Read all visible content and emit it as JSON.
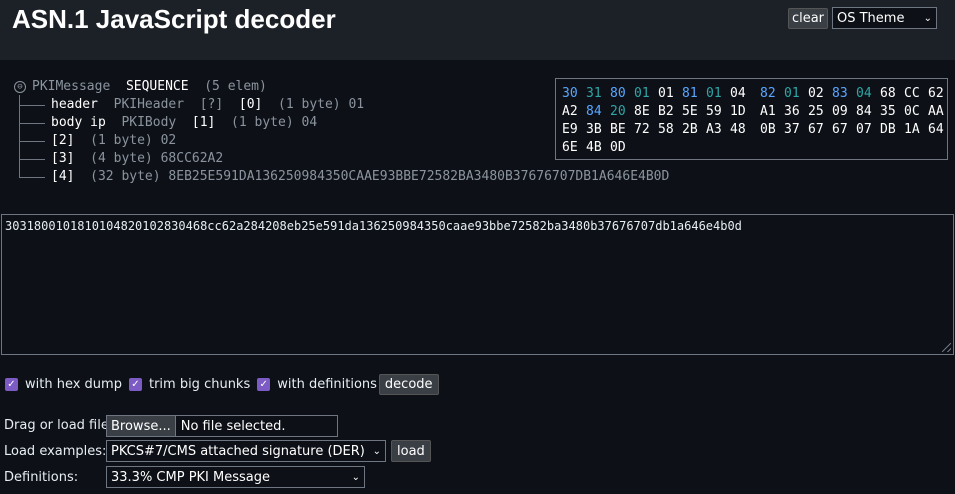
{
  "header": {
    "title": "ASN.1 JavaScript decoder",
    "clear_label": "clear",
    "theme_value": "OS Theme"
  },
  "tree": {
    "root": {
      "toggle": "⊖",
      "name": "PKIMessage",
      "type": "SEQUENCE",
      "info": "(5 elem)"
    },
    "children": [
      {
        "name": "header",
        "type": "PKIHeader",
        "extra": "[?]",
        "tag": "[0]",
        "info": "(1 byte)",
        "value": "01"
      },
      {
        "name": "body ip",
        "type": "PKIBody",
        "tag": "[1]",
        "info": "(1 byte)",
        "value": "04"
      },
      {
        "tag": "[2]",
        "info": "(1 byte)",
        "value": "02"
      },
      {
        "tag": "[3]",
        "info": "(4 byte)",
        "value": "68CC62A2"
      },
      {
        "tag": "[4]",
        "info": "(32 byte)",
        "value": "8EB25E591DA136250984350CAAE93BBE72582BA3480B37676707DB1A646E4B0D"
      }
    ]
  },
  "hexdump": {
    "rows": [
      [
        {
          "t": "30",
          "c": "blue"
        },
        {
          "t": "31",
          "c": "teal"
        },
        {
          "t": "80",
          "c": "blue"
        },
        {
          "t": "01",
          "c": "teal"
        },
        {
          "t": "01",
          "c": "white"
        },
        {
          "t": "81",
          "c": "blue"
        },
        {
          "t": "01",
          "c": "teal"
        },
        {
          "t": "04",
          "c": "white"
        },
        {
          "t": "82",
          "c": "blue"
        },
        {
          "t": "01",
          "c": "teal"
        },
        {
          "t": "02",
          "c": "white"
        },
        {
          "t": "83",
          "c": "blue"
        },
        {
          "t": "04",
          "c": "teal"
        },
        {
          "t": "68",
          "c": "white"
        },
        {
          "t": "CC",
          "c": "white"
        },
        {
          "t": "62",
          "c": "white"
        }
      ],
      [
        {
          "t": "A2",
          "c": "white"
        },
        {
          "t": "84",
          "c": "blue"
        },
        {
          "t": "20",
          "c": "teal"
        },
        {
          "t": "8E",
          "c": "white"
        },
        {
          "t": "B2",
          "c": "white"
        },
        {
          "t": "5E",
          "c": "white"
        },
        {
          "t": "59",
          "c": "white"
        },
        {
          "t": "1D",
          "c": "white"
        },
        {
          "t": "A1",
          "c": "white"
        },
        {
          "t": "36",
          "c": "white"
        },
        {
          "t": "25",
          "c": "white"
        },
        {
          "t": "09",
          "c": "white"
        },
        {
          "t": "84",
          "c": "white"
        },
        {
          "t": "35",
          "c": "white"
        },
        {
          "t": "0C",
          "c": "white"
        },
        {
          "t": "AA",
          "c": "white"
        }
      ],
      [
        {
          "t": "E9",
          "c": "white"
        },
        {
          "t": "3B",
          "c": "white"
        },
        {
          "t": "BE",
          "c": "white"
        },
        {
          "t": "72",
          "c": "white"
        },
        {
          "t": "58",
          "c": "white"
        },
        {
          "t": "2B",
          "c": "white"
        },
        {
          "t": "A3",
          "c": "white"
        },
        {
          "t": "48",
          "c": "white"
        },
        {
          "t": "0B",
          "c": "white"
        },
        {
          "t": "37",
          "c": "white"
        },
        {
          "t": "67",
          "c": "white"
        },
        {
          "t": "67",
          "c": "white"
        },
        {
          "t": "07",
          "c": "white"
        },
        {
          "t": "DB",
          "c": "white"
        },
        {
          "t": "1A",
          "c": "white"
        },
        {
          "t": "64",
          "c": "white"
        }
      ],
      [
        {
          "t": "6E",
          "c": "white"
        },
        {
          "t": "4B",
          "c": "white"
        },
        {
          "t": "0D",
          "c": "white"
        }
      ]
    ]
  },
  "input": {
    "value": "303180010181010482010283046 8cc62a284208eb25e591da136250984350caae93bbe72582ba3480b37676707db1a646e4b0d"
  },
  "options": {
    "hex_dump_label": "with hex dump",
    "trim_label": "trim big chunks",
    "definitions_label": "with definitions",
    "decode_label": "decode"
  },
  "file": {
    "label": "Drag or load file:",
    "browse_label": "Browse...",
    "status": "No file selected."
  },
  "examples": {
    "label": "Load examples:",
    "selected": "PKCS#7/CMS attached signature (DER)",
    "load_label": "load"
  },
  "definitions": {
    "label": "Definitions:",
    "selected": "33.3% CMP PKI Message"
  },
  "colors": {
    "background": "#0d1117",
    "header": "#1c2128",
    "checkbox": "#7c5cc4",
    "hex_tag": "#58a6ff",
    "hex_length": "#2ea6a6"
  }
}
